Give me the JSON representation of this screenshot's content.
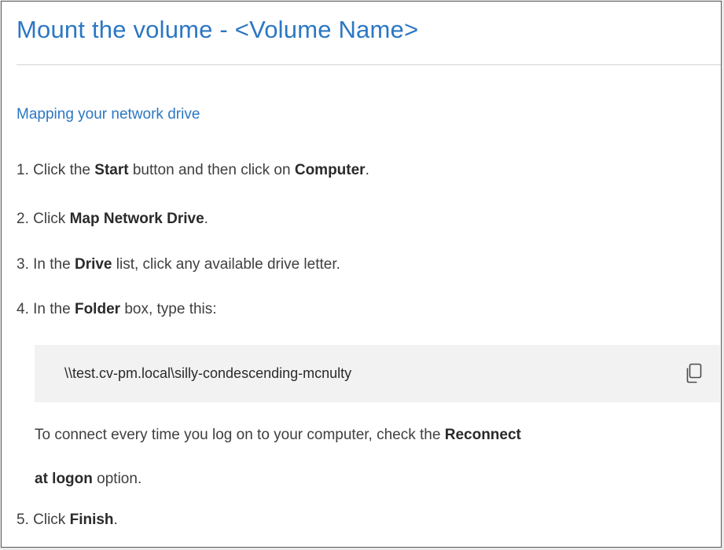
{
  "title": "Mount the volume - <Volume Name>",
  "subtitle": "Mapping your network drive",
  "steps": [
    {
      "num": "1.",
      "t1": "Click the",
      "b1": "Start",
      "t2": "button and then click on",
      "b2": "Computer",
      "t3": "."
    },
    {
      "num": "2.",
      "t1": "Click",
      "b1": "Map Network Drive",
      "t2": "."
    },
    {
      "num": "3.",
      "t1": "In the",
      "b1": "Drive",
      "t2": "list, click any available drive letter."
    },
    {
      "num": "4.",
      "t1": "In the",
      "b1": "Folder",
      "t2": "box, type this:"
    },
    {
      "num": "5.",
      "t1": "Click",
      "b1": "Finish",
      "t2": "."
    }
  ],
  "path_box": {
    "path": "\\\\test.cv-pm.local\\silly-condescending-mcnulty",
    "copy_icon": "copy-icon"
  },
  "note": {
    "line1_text": "To connect every time you log on to your computer, check the",
    "line1_bold": "Reconnect",
    "line2_bold": "at logon",
    "line2_text": "option."
  },
  "colors": {
    "accent": "#2c77c4",
    "text": "#3f3f3f",
    "code_bg": "#f2f2f2",
    "divider": "#d4d4d4"
  }
}
